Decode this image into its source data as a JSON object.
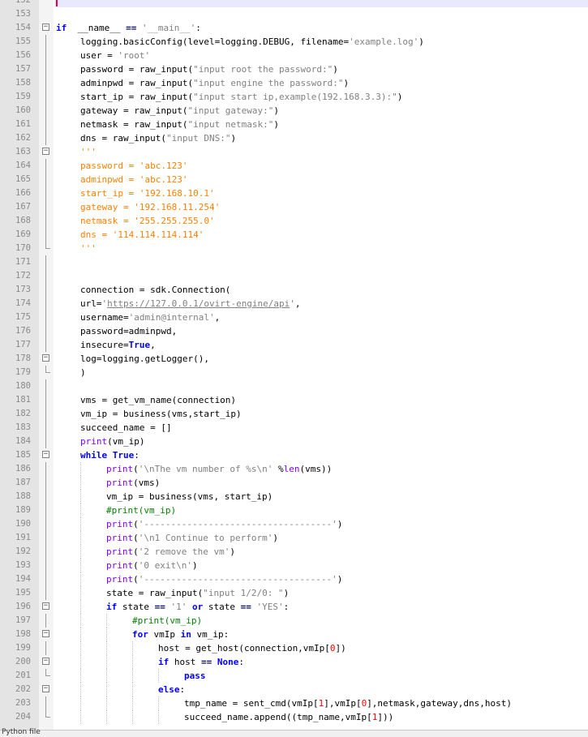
{
  "editor": {
    "current_line": 152,
    "lines": [
      {
        "n": 152,
        "indent": 0,
        "fold": "",
        "tokens": []
      },
      {
        "n": 153,
        "indent": 0,
        "fold": "",
        "tokens": []
      },
      {
        "n": 154,
        "indent": 0,
        "fold": "box",
        "tokens": [
          [
            "kw",
            "if"
          ],
          [
            "",
            "  __name__ "
          ],
          [
            "op",
            "=="
          ],
          [
            "str",
            " '__main__'"
          ],
          [
            "",
            ":"
          ]
        ]
      },
      {
        "n": 155,
        "indent": 1,
        "fold": "line",
        "tokens": [
          [
            "",
            "logging.basicConfig(level=logging.DEBUG, filename="
          ],
          [
            "str",
            "'example.log'"
          ],
          [
            "",
            ")"
          ]
        ]
      },
      {
        "n": 156,
        "indent": 1,
        "fold": "line",
        "tokens": [
          [
            "",
            "user = "
          ],
          [
            "str",
            "'root'"
          ]
        ]
      },
      {
        "n": 157,
        "indent": 1,
        "fold": "line",
        "tokens": [
          [
            "",
            "password = raw_input("
          ],
          [
            "dstr",
            "\"input root the password:\""
          ],
          [
            "",
            ")"
          ]
        ]
      },
      {
        "n": 158,
        "indent": 1,
        "fold": "line",
        "tokens": [
          [
            "",
            "adminpwd = raw_input("
          ],
          [
            "dstr",
            "\"input engine the password:\""
          ],
          [
            "",
            ")"
          ]
        ]
      },
      {
        "n": 159,
        "indent": 1,
        "fold": "line",
        "tokens": [
          [
            "",
            "start_ip = raw_input("
          ],
          [
            "dstr",
            "\"input start ip,example(192.168.3.3):\""
          ],
          [
            "",
            ")"
          ]
        ]
      },
      {
        "n": 160,
        "indent": 1,
        "fold": "line",
        "tokens": [
          [
            "",
            "gateway = raw_input("
          ],
          [
            "dstr",
            "\"input gateway:\""
          ],
          [
            "",
            ")"
          ]
        ]
      },
      {
        "n": 161,
        "indent": 1,
        "fold": "line",
        "tokens": [
          [
            "",
            "netmask = raw_input("
          ],
          [
            "dstr",
            "\"input netmask:\""
          ],
          [
            "",
            ")"
          ]
        ]
      },
      {
        "n": 162,
        "indent": 1,
        "fold": "line",
        "tokens": [
          [
            "",
            "dns = raw_input("
          ],
          [
            "dstr",
            "\"input DNS:\""
          ],
          [
            "",
            ")"
          ]
        ]
      },
      {
        "n": 163,
        "indent": 1,
        "fold": "box",
        "tokens": [
          [
            "orange",
            "'''"
          ]
        ]
      },
      {
        "n": 164,
        "indent": 1,
        "fold": "line",
        "tokens": [
          [
            "orange",
            "password = 'abc.123'"
          ]
        ]
      },
      {
        "n": 165,
        "indent": 1,
        "fold": "line",
        "tokens": [
          [
            "orange",
            "adminpwd = 'abc.123'"
          ]
        ]
      },
      {
        "n": 166,
        "indent": 1,
        "fold": "line",
        "tokens": [
          [
            "orange",
            "start_ip = '192.168.10.1'"
          ]
        ]
      },
      {
        "n": 167,
        "indent": 1,
        "fold": "line",
        "tokens": [
          [
            "orange",
            "gateway = '192.168.11.254'"
          ]
        ]
      },
      {
        "n": 168,
        "indent": 1,
        "fold": "line",
        "tokens": [
          [
            "orange",
            "netmask = '255.255.255.0'"
          ]
        ]
      },
      {
        "n": 169,
        "indent": 1,
        "fold": "line",
        "tokens": [
          [
            "orange",
            "dns = '114.114.114.114'"
          ]
        ]
      },
      {
        "n": 170,
        "indent": 1,
        "fold": "end",
        "tokens": [
          [
            "orange",
            "'''"
          ]
        ]
      },
      {
        "n": 171,
        "indent": 0,
        "fold": "line",
        "tokens": []
      },
      {
        "n": 172,
        "indent": 0,
        "fold": "line",
        "tokens": []
      },
      {
        "n": 173,
        "indent": 1,
        "fold": "line",
        "tokens": [
          [
            "",
            "connection = sdk.Connection("
          ]
        ]
      },
      {
        "n": 174,
        "indent": 1,
        "fold": "line",
        "tokens": [
          [
            "",
            "url="
          ],
          [
            "str",
            "'"
          ],
          [
            "url",
            "https://127.0.0.1/ovirt-engine/api"
          ],
          [
            "str",
            "'"
          ],
          [
            "",
            ","
          ]
        ]
      },
      {
        "n": 175,
        "indent": 1,
        "fold": "line",
        "tokens": [
          [
            "",
            "username="
          ],
          [
            "str",
            "'admin@internal'"
          ],
          [
            "",
            ","
          ]
        ]
      },
      {
        "n": 176,
        "indent": 1,
        "fold": "line",
        "tokens": [
          [
            "",
            "password=adminpwd,"
          ]
        ]
      },
      {
        "n": 177,
        "indent": 1,
        "fold": "line",
        "tokens": [
          [
            "",
            "insecure="
          ],
          [
            "kw",
            "True"
          ],
          [
            "",
            ","
          ]
        ]
      },
      {
        "n": 178,
        "indent": 1,
        "fold": "box",
        "tokens": [
          [
            "",
            "log=logging.getLogger(),"
          ]
        ]
      },
      {
        "n": 179,
        "indent": 1,
        "fold": "end",
        "tokens": [
          [
            "",
            ")"
          ]
        ]
      },
      {
        "n": 180,
        "indent": 0,
        "fold": "line",
        "tokens": []
      },
      {
        "n": 181,
        "indent": 1,
        "fold": "line",
        "tokens": [
          [
            "",
            "vms = get_vm_name(connection)"
          ]
        ]
      },
      {
        "n": 182,
        "indent": 1,
        "fold": "line",
        "tokens": [
          [
            "",
            "vm_ip = business(vms,start_ip)"
          ]
        ]
      },
      {
        "n": 183,
        "indent": 1,
        "fold": "line",
        "tokens": [
          [
            "",
            "succeed_name = []"
          ]
        ]
      },
      {
        "n": 184,
        "indent": 1,
        "fold": "line",
        "tokens": [
          [
            "bi",
            "print"
          ],
          [
            "",
            "(vm_ip)"
          ]
        ]
      },
      {
        "n": 185,
        "indent": 1,
        "fold": "box",
        "tokens": [
          [
            "kw",
            "while"
          ],
          [
            "kw",
            " True"
          ],
          [
            "",
            ":"
          ]
        ]
      },
      {
        "n": 186,
        "indent": 2,
        "fold": "line",
        "tokens": [
          [
            "bi",
            "print"
          ],
          [
            "",
            "("
          ],
          [
            "str",
            "'\\nThe vm number of %s\\n'"
          ],
          [
            "",
            " %"
          ],
          [
            "bi",
            "len"
          ],
          [
            "",
            "(vms))"
          ]
        ]
      },
      {
        "n": 187,
        "indent": 2,
        "fold": "line",
        "tokens": [
          [
            "bi",
            "print"
          ],
          [
            "",
            "(vms)"
          ]
        ]
      },
      {
        "n": 188,
        "indent": 2,
        "fold": "line",
        "tokens": [
          [
            "",
            "vm_ip = business(vms, start_ip)"
          ]
        ]
      },
      {
        "n": 189,
        "indent": 2,
        "fold": "line",
        "tokens": [
          [
            "cmt",
            "#print(vm_ip)"
          ]
        ]
      },
      {
        "n": 190,
        "indent": 2,
        "fold": "line",
        "tokens": [
          [
            "bi",
            "print"
          ],
          [
            "",
            "("
          ],
          [
            "str",
            "'-----------------------------------'"
          ],
          [
            "",
            ")"
          ]
        ]
      },
      {
        "n": 191,
        "indent": 2,
        "fold": "line",
        "tokens": [
          [
            "bi",
            "print"
          ],
          [
            "",
            "("
          ],
          [
            "str",
            "'\\n1 Continue to perform'"
          ],
          [
            "",
            ")"
          ]
        ]
      },
      {
        "n": 192,
        "indent": 2,
        "fold": "line",
        "tokens": [
          [
            "bi",
            "print"
          ],
          [
            "",
            "("
          ],
          [
            "str",
            "'2 remove the vm'"
          ],
          [
            "",
            ")"
          ]
        ]
      },
      {
        "n": 193,
        "indent": 2,
        "fold": "line",
        "tokens": [
          [
            "bi",
            "print"
          ],
          [
            "",
            "("
          ],
          [
            "str",
            "'0 exit\\n'"
          ],
          [
            "",
            ")"
          ]
        ]
      },
      {
        "n": 194,
        "indent": 2,
        "fold": "line",
        "tokens": [
          [
            "bi",
            "print"
          ],
          [
            "",
            "("
          ],
          [
            "str",
            "'-----------------------------------'"
          ],
          [
            "",
            ")"
          ]
        ]
      },
      {
        "n": 195,
        "indent": 2,
        "fold": "line",
        "tokens": [
          [
            "",
            "state = raw_input("
          ],
          [
            "dstr",
            "\"input 1/2/0: \""
          ],
          [
            "",
            ")"
          ]
        ]
      },
      {
        "n": 196,
        "indent": 2,
        "fold": "box",
        "tokens": [
          [
            "kw",
            "if"
          ],
          [
            "",
            " state "
          ],
          [
            "op",
            "=="
          ],
          [
            "str",
            " '1'"
          ],
          [
            "kw",
            " or"
          ],
          [
            "",
            " state "
          ],
          [
            "op",
            "=="
          ],
          [
            "str",
            " 'YES'"
          ],
          [
            "",
            ":"
          ]
        ]
      },
      {
        "n": 197,
        "indent": 3,
        "fold": "line",
        "tokens": [
          [
            "cmt",
            "#print(vm_ip)"
          ]
        ]
      },
      {
        "n": 198,
        "indent": 3,
        "fold": "box",
        "tokens": [
          [
            "kw",
            "for"
          ],
          [
            "",
            " vmIp "
          ],
          [
            "kw",
            "in"
          ],
          [
            "",
            " vm_ip:"
          ]
        ]
      },
      {
        "n": 199,
        "indent": 4,
        "fold": "line",
        "tokens": [
          [
            "",
            "host = get_host(connection,vmIp["
          ],
          [
            "num",
            "0"
          ],
          [
            "",
            "])"
          ]
        ]
      },
      {
        "n": 200,
        "indent": 4,
        "fold": "box",
        "tokens": [
          [
            "kw",
            "if"
          ],
          [
            "",
            " host "
          ],
          [
            "op",
            "=="
          ],
          [
            "kw",
            " None"
          ],
          [
            "",
            ":"
          ]
        ]
      },
      {
        "n": 201,
        "indent": 5,
        "fold": "end",
        "tokens": [
          [
            "kw",
            "pass"
          ]
        ]
      },
      {
        "n": 202,
        "indent": 4,
        "fold": "box",
        "tokens": [
          [
            "kw",
            "else"
          ],
          [
            "",
            ":"
          ]
        ]
      },
      {
        "n": 203,
        "indent": 5,
        "fold": "line",
        "tokens": [
          [
            "",
            "tmp_name = sent_cmd(vmIp["
          ],
          [
            "num",
            "1"
          ],
          [
            "",
            "],vmIp["
          ],
          [
            "num",
            "0"
          ],
          [
            "",
            "],netmask,gateway,dns,host)"
          ]
        ]
      },
      {
        "n": 204,
        "indent": 5,
        "fold": "end",
        "tokens": [
          [
            "",
            "succeed_name.append((tmp_name,vmIp["
          ],
          [
            "num",
            "1"
          ],
          [
            "",
            "]))"
          ]
        ]
      }
    ]
  },
  "status": {
    "text": "Python file"
  }
}
